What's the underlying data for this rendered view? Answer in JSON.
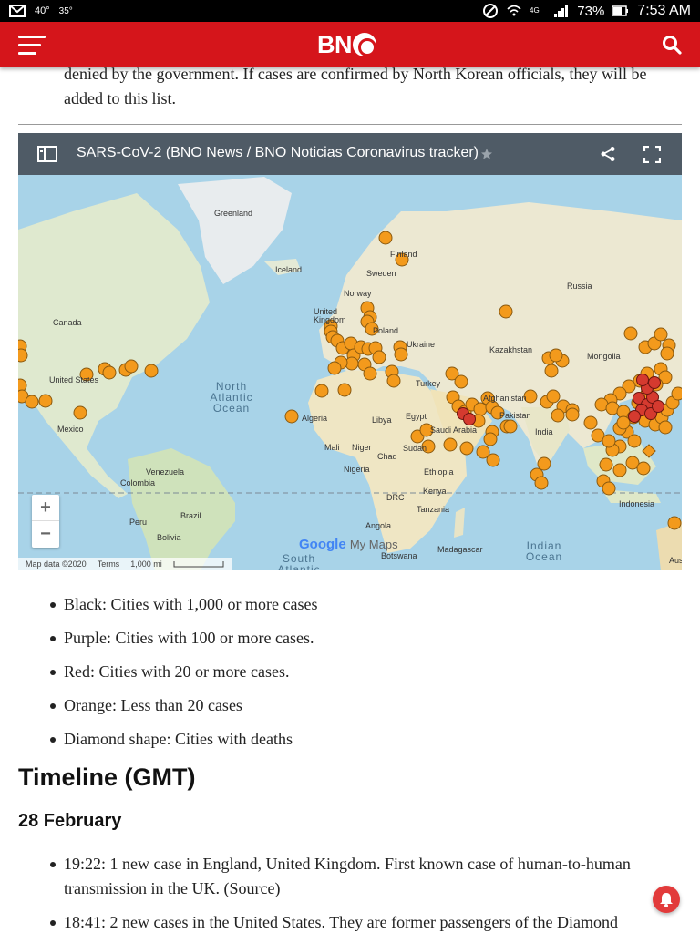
{
  "status_bar": {
    "temp_high": "40°",
    "temp_low": "35°",
    "battery": "73%",
    "time": "7:53 AM"
  },
  "header": {
    "logo": "BN"
  },
  "article": {
    "intro": "denied by the government. If cases are confirmed by North Korean officials, they will be added to this list."
  },
  "map": {
    "title": "SARS-CoV-2 (BNO News / BNO Noticias Coronavirus tracker)",
    "footer": {
      "data": "Map data ©2020",
      "terms": "Terms",
      "scale": "1,000 mi"
    },
    "brand": "Google",
    "brand_suffix": "My Maps",
    "labels": {
      "greenland": "Greenland",
      "iceland": "Iceland",
      "finland": "Finland",
      "sweden": "Sweden",
      "norway": "Norway",
      "russia": "Russia",
      "united_kingdom": "United Kingdom",
      "poland": "Poland",
      "ukraine": "Ukraine",
      "kazakhstan": "Kazakhstan",
      "mongolia": "Mongolia",
      "canada": "Canada",
      "united_states": "United States",
      "mexico": "Mexico",
      "turkey": "Turkey",
      "afghanistan": "Afghanistan",
      "pakistan": "Pakistan",
      "india": "India",
      "saudi_arabia": "Saudi Arabia",
      "egypt": "Egypt",
      "algeria": "Algeria",
      "libya": "Libya",
      "mali": "Mali",
      "niger": "Niger",
      "chad": "Chad",
      "sudan": "Sudan",
      "nigeria": "Nigeria",
      "ethiopia": "Ethiopia",
      "venezuela": "Venezuela",
      "colombia": "Colombia",
      "peru": "Peru",
      "brazil": "Brazil",
      "bolivia": "Bolivia",
      "drc": "DRC",
      "kenya": "Kenya",
      "tanzania": "Tanzania",
      "angola": "Angola",
      "botswana": "Botswana",
      "madagascar": "Madagascar",
      "indonesia": "Indonesia",
      "australia_partial": "Aus"
    },
    "oceans": {
      "north_atlantic": "North Atlantic Ocean",
      "south_atlantic": "South Atlantic",
      "indian": "Indian Ocean"
    },
    "zoom_in": "+",
    "zoom_out": "−"
  },
  "legend": [
    "Black: Cities with 1,000 or more cases",
    "Purple: Cities with 100 or more cases.",
    "Red: Cities with 20 or more cases.",
    "Orange: Less than 20 cases",
    "Diamond shape: Cities with deaths"
  ],
  "timeline": {
    "heading": "Timeline (GMT)",
    "date": "28 February",
    "entries": [
      "19:22: 1 new case in England, United Kingdom. First known case of human-to-human transmission in the UK. (Source)",
      "18:41: 2 new cases in the United States. They are former passengers of the Diamond"
    ]
  },
  "colors": {
    "brand_red": "#d5151b",
    "marker_orange": "#f39a1c",
    "marker_red": "#d53a2f",
    "map_header": "#4f5b66"
  }
}
